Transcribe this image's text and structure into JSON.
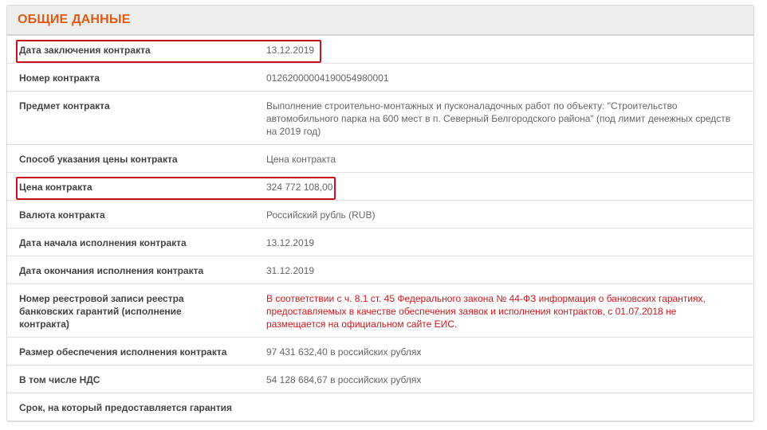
{
  "section": {
    "title": "ОБЩИЕ ДАННЫЕ"
  },
  "rows": [
    {
      "label": "Дата заключения контракта",
      "value": "13.12.2019",
      "highlighted": true
    },
    {
      "label": "Номер контракта",
      "value": "0126200000419005498000​1",
      "highlighted": false
    },
    {
      "label": "Предмет контракта",
      "value": "Выполнение строительно-монтажных и пусконаладочных работ по объекту: \"Строительство автомобильного парка на 600 мест в п. Северный Белгородского района\" (под лимит денежных средств на 2019 год)",
      "highlighted": false
    },
    {
      "label": "Способ указания цены контракта",
      "value": "Цена контракта",
      "highlighted": false
    },
    {
      "label": "Цена контракта",
      "value": "324 772 108,00",
      "highlighted": true
    },
    {
      "label": "Валюта контракта",
      "value": "Российский рубль (RUB)",
      "highlighted": false
    },
    {
      "label": "Дата начала исполнения контракта",
      "value": "13.12.2019",
      "highlighted": false
    },
    {
      "label": "Дата окончания исполнения контракта",
      "value": "31.12.2019",
      "highlighted": false
    },
    {
      "label": "Номер реестровой записи реестра банковских гарантий (исполнение контракта)",
      "value": "В соответствии с ч. 8.1 ст. 45 Федерального закона № 44-ФЗ информация о банковских гарантиях, предоставляемых в качестве обеспечения заявок и исполнения контрактов, с 01.07.2018 не размещается на официальном сайте ЕИС.",
      "highlighted": false,
      "value_color": "#d2161a"
    },
    {
      "label": "Размер обеспечения исполнения контракта",
      "value": "97 431 632,40 в российских рублях",
      "highlighted": false
    },
    {
      "label": "В том числе НДС",
      "value": "54 128 684,67 в российских рублях",
      "highlighted": false
    },
    {
      "label": "Срок, на который предоставляется гарантия",
      "value": "",
      "highlighted": false
    }
  ],
  "colors": {
    "accent": "#e05a12",
    "highlight_border": "#c8101e",
    "warning_text": "#d2161a"
  }
}
